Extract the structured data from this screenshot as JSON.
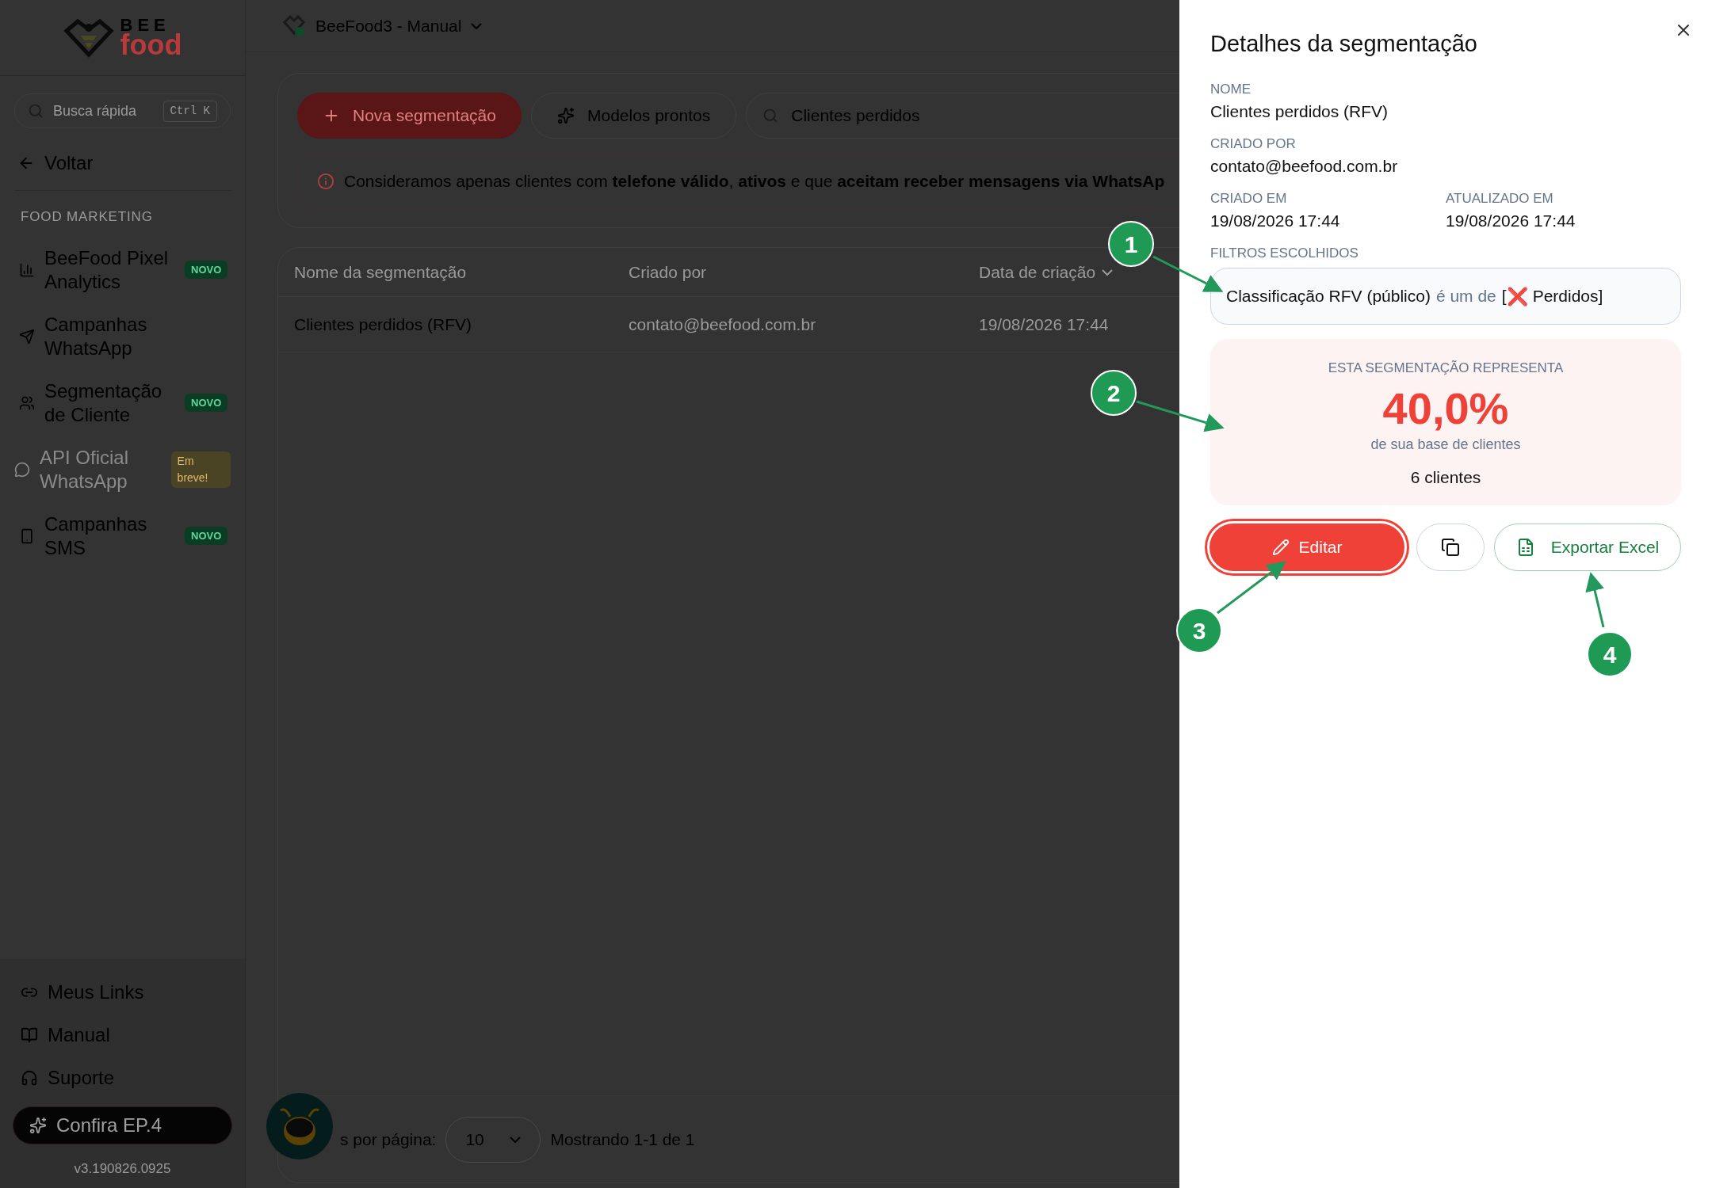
{
  "sidebar": {
    "logo": {
      "top": "BEE",
      "bottom": "food"
    },
    "search": {
      "placeholder": "Busca rápida",
      "shortcut": "Ctrl K"
    },
    "back": "Voltar",
    "section": "FOOD MARKETING",
    "items": [
      {
        "label": "BeeFood Pixel Analytics",
        "badge": {
          "text": "NOVO",
          "kind": "new"
        },
        "disabled": false
      },
      {
        "label": "Campanhas WhatsApp",
        "disabled": false
      },
      {
        "label": "Segmentação de Cliente",
        "badge": {
          "text": "NOVO",
          "kind": "new"
        },
        "disabled": false
      },
      {
        "label": "API Oficial WhatsApp",
        "badge": {
          "text": "Em breve!",
          "kind": "soon"
        },
        "disabled": true
      },
      {
        "label": "Campanhas SMS",
        "badge": {
          "text": "NOVO",
          "kind": "new"
        },
        "disabled": false
      }
    ],
    "footer_links": [
      "Meus Links",
      "Manual",
      "Suporte"
    ],
    "promo_button": "Confira EP.4",
    "version": "v3.190826.0925"
  },
  "topbar": {
    "store": "BeeFood3 - Manual"
  },
  "toolbar": {
    "new_button": "Nova segmentação",
    "templates_button": "Modelos prontos",
    "search": {
      "value": "Clientes perdidos"
    }
  },
  "alert": "Consideramos apenas clientes com **telefone válido**, **ativos** e que **aceitam receber mensagens via WhatsAp**",
  "table": {
    "columns": [
      {
        "label": "Nome da segmentação",
        "sortable": false
      },
      {
        "label": "Criado por",
        "sortable": false
      },
      {
        "label": "Data de criação",
        "sortable": true
      }
    ],
    "rows": [
      {
        "cells": [
          "Clientes perdidos (RFV)",
          "contato@beefood.com.br",
          "19/08/2026 17:44"
        ]
      }
    ],
    "per_page_label": "s por página:",
    "per_page": "10",
    "showing": "Mostrando 1-1 de 1"
  },
  "panel": {
    "title": "Detalhes da segmentação",
    "fields": [
      {
        "label": "NOME",
        "value": "Clientes perdidos (RFV)"
      },
      {
        "label": "CRIADO POR",
        "value": "contato@beefood.com.br"
      }
    ],
    "dates": [
      {
        "label": "CRIADO EM",
        "value": "19/08/2026 17:44"
      },
      {
        "label": "ATUALIZADO EM",
        "value": "19/08/2026 17:44"
      }
    ],
    "filters_label": "FILTROS ESCOLHIDOS",
    "filters": [
      {
        "field": "Classificação RFV (público)",
        "operator": "é um de",
        "open": "[",
        "mark": "❌",
        "value": "Perdidos]"
      }
    ],
    "stat": {
      "label": "ESTA SEGMENTAÇÃO REPRESENTA",
      "percent": "40,0%",
      "caption": "de sua base de clientes",
      "count": "6 clientes"
    },
    "edit_button": "Editar",
    "export_button": "Exportar Excel"
  },
  "annotations": [
    {
      "label": "1"
    },
    {
      "label": "2"
    },
    {
      "label": "3"
    },
    {
      "label": "4"
    }
  ]
}
